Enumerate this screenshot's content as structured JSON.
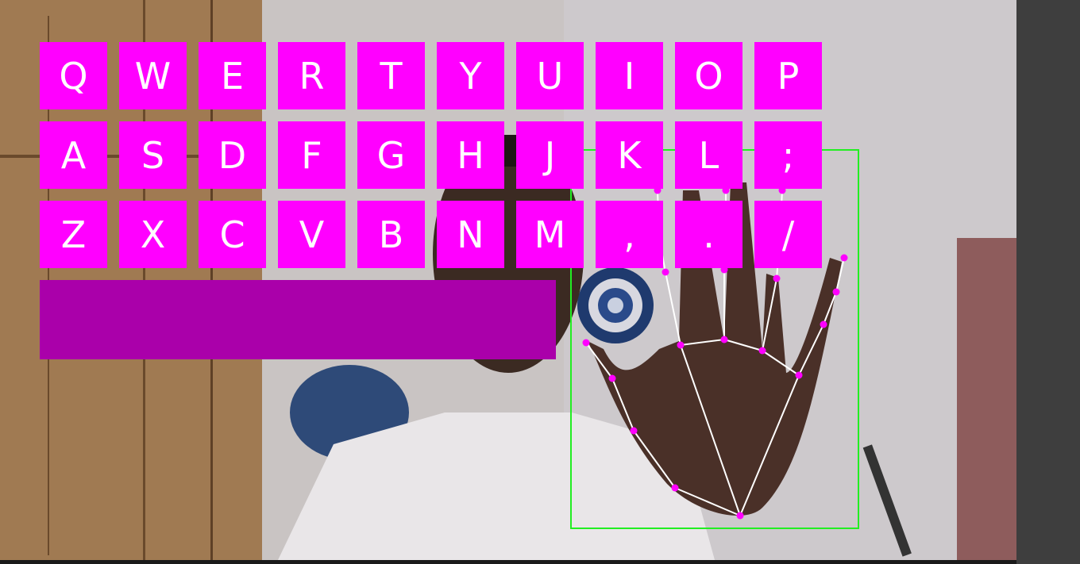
{
  "keyboard": {
    "rows": [
      [
        "Q",
        "W",
        "E",
        "R",
        "T",
        "Y",
        "U",
        "I",
        "O",
        "P"
      ],
      [
        "A",
        "S",
        "D",
        "F",
        "G",
        "H",
        "J",
        "K",
        "L",
        ";"
      ],
      [
        "Z",
        "X",
        "C",
        "V",
        "B",
        "N",
        "M",
        ",",
        ".",
        "/"
      ]
    ],
    "key_color": "#ff00ff",
    "text_color": "#ffffff"
  },
  "text_output": {
    "value": "",
    "color": "#aa00aa"
  },
  "detection": {
    "box_color": "#22ee22",
    "landmark_color": "#ff00ff",
    "connection_color": "#ffffff"
  }
}
